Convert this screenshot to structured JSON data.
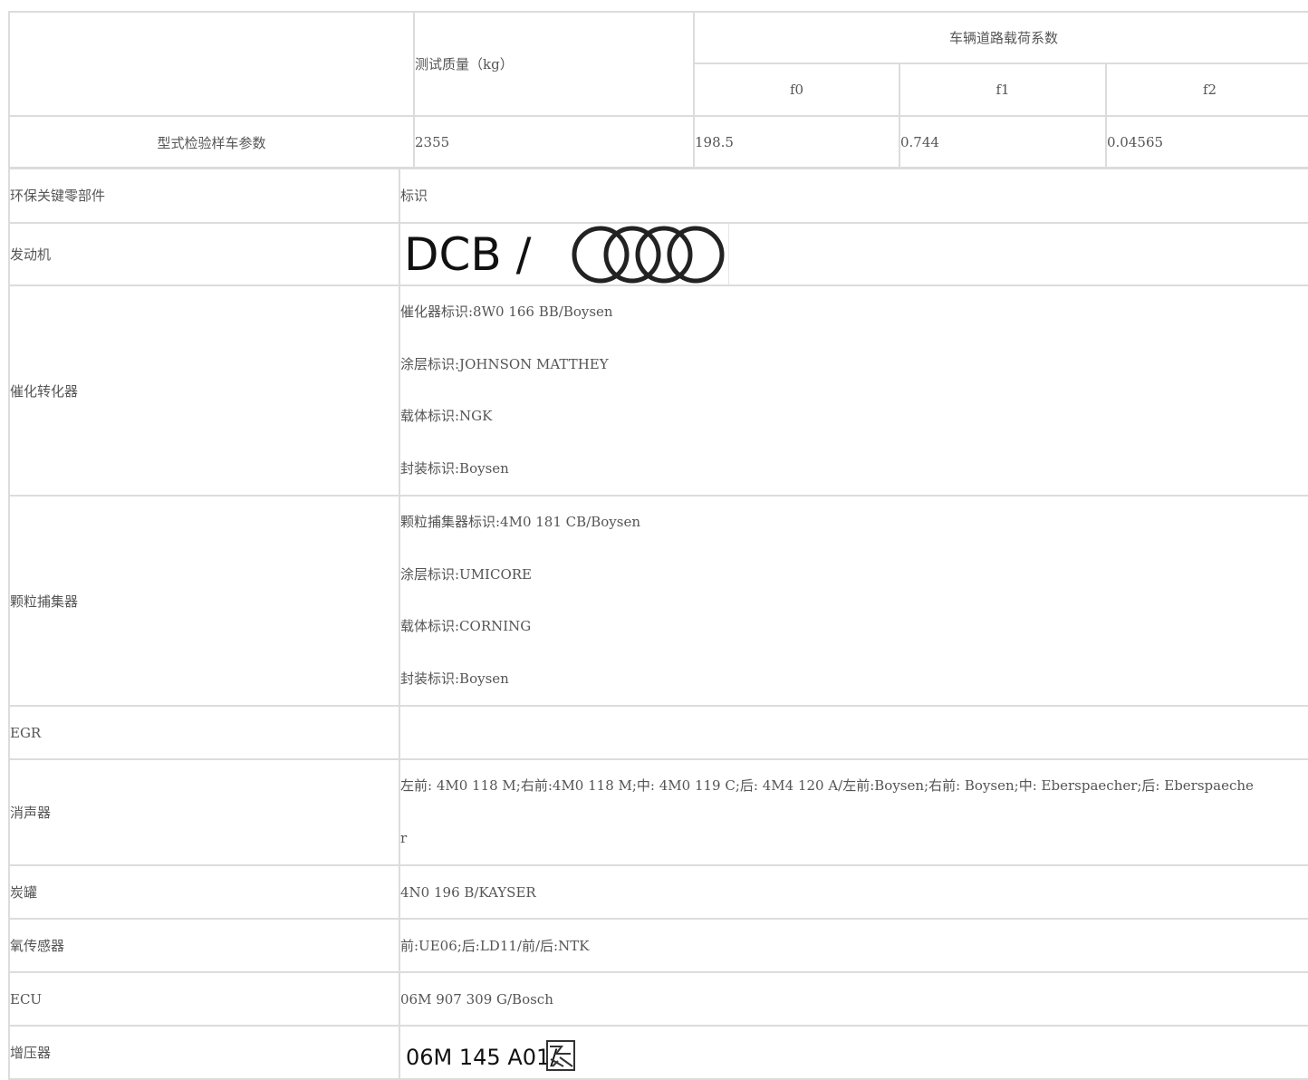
{
  "load_table": {
    "mass_header": "测试质量（kg）",
    "coef_header": "车辆道路载荷系数",
    "coef_cols": [
      "f0",
      "f1",
      "f2"
    ],
    "row_label": "型式检验样车参数",
    "mass_value": "2355",
    "coef_values": [
      "198.5",
      "0.744",
      "0.04565"
    ]
  },
  "parts_table": {
    "col_component": "环保关键零部件",
    "col_mark": "标识",
    "engine": {
      "label": "发动机",
      "image_text": "DCB /"
    },
    "catalyst": {
      "label": "催化转化器",
      "lines": [
        "催化器标识:8W0 166 BB/Boysen",
        "涂层标识:JOHNSON MATTHEY",
        "载体标识:NGK",
        "封装标识:Boysen"
      ]
    },
    "dpf": {
      "label": "颗粒捕集器",
      "lines": [
        "颗粒捕集器标识:4M0 181 CB/Boysen",
        "涂层标识:UMICORE",
        "载体标识:CORNING",
        "封装标识:Boysen"
      ]
    },
    "egr": {
      "label": "EGR",
      "value": ""
    },
    "muffler": {
      "label": "消声器",
      "line1": "左前: 4M0 118 M;右前:4M0 118 M;中: 4M0 119 C;后: 4M4 120 A/左前:Boysen;右前: Boysen;中: Eberspaecher;后: Eberspaeche",
      "line2": "r"
    },
    "canister": {
      "label": "炭罐",
      "value": "4N0 196 B/KAYSER"
    },
    "o2_sensor": {
      "label": "氧传感器",
      "value": "前:UE06;后:LD11/前/后:NTK"
    },
    "ecu": {
      "label": "ECU",
      "value": "06M 907 309 G/Bosch"
    },
    "turbo": {
      "label": "增压器",
      "image_text": "06M 145 A01/"
    }
  }
}
